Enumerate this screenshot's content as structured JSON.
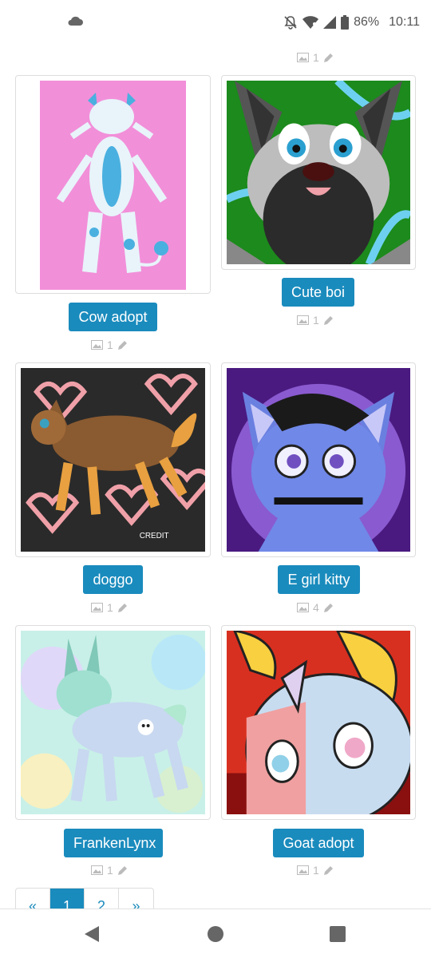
{
  "status_bar": {
    "left_icon": "cloud-icon",
    "icons": [
      "notifications-off-icon",
      "wifi-icon",
      "signal-icon",
      "battery-icon"
    ],
    "battery": "86%",
    "time": "10:11"
  },
  "top_meta": {
    "image_count": "1"
  },
  "characters": [
    {
      "name": "Cow adopt",
      "image_count": "1"
    },
    {
      "name": "Cute boi",
      "image_count": "1"
    },
    {
      "name": "doggo",
      "image_count": "1"
    },
    {
      "name": "E girl kitty",
      "image_count": "4"
    },
    {
      "name": "FrankenLynx",
      "image_count": "1"
    },
    {
      "name": "Goat adopt",
      "image_count": "1"
    }
  ],
  "pagination": {
    "prev": "«",
    "pages": [
      "1",
      "2"
    ],
    "next": "»",
    "current": "1"
  },
  "colors": {
    "accent": "#1a8bbd",
    "border": "#dddddd",
    "meta_icon": "#bbbbbb"
  }
}
